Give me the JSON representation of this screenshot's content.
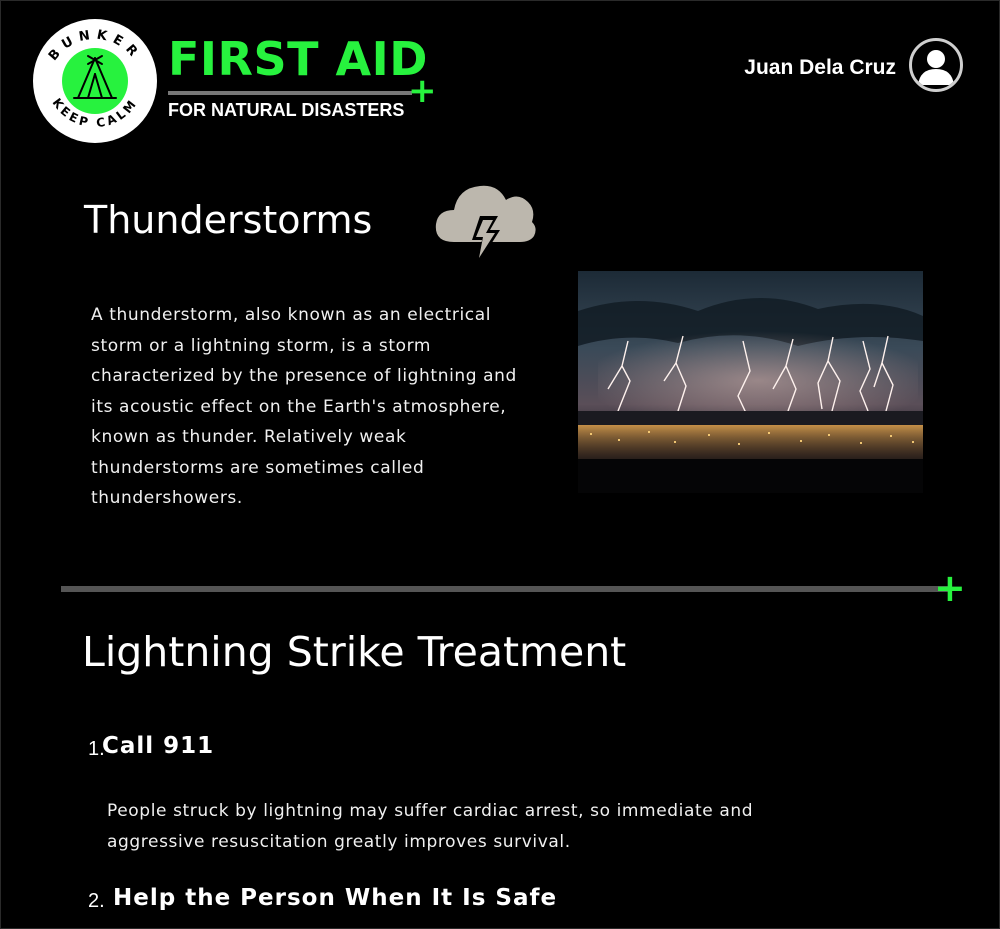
{
  "header": {
    "logo_text_top": "BUNKER",
    "logo_text_bottom": "KEEP CALM",
    "brand_title": "FIRST AID",
    "brand_subtitle": "FOR NATURAL DISASTERS",
    "brand_plus": "+",
    "user_name": "Juan Dela Cruz"
  },
  "section1": {
    "title": "Thunderstorms",
    "icon": "thunderstorm-icon",
    "description": "A thunderstorm, also known as an electrical storm or a lightning storm, is a storm characterized by the presence of lightning and its acoustic effect on the Earth's atmosphere, known as thunder. Relatively weak thunderstorms are sometimes called thundershowers.",
    "image": "lightning-storm-photo"
  },
  "divider": {
    "plus": "+"
  },
  "section2": {
    "title": "Lightning Strike Treatment",
    "steps": [
      {
        "number": "1.",
        "title": "Call 911",
        "description": "People struck by lightning may suffer cardiac arrest, so immediate and aggressive resuscitation greatly improves survival."
      },
      {
        "number": "2.",
        "title": "Help the Person When It Is Safe"
      }
    ]
  },
  "colors": {
    "accent": "#27f23e",
    "background": "#000000",
    "text": "#ffffff",
    "divider": "#555555"
  }
}
